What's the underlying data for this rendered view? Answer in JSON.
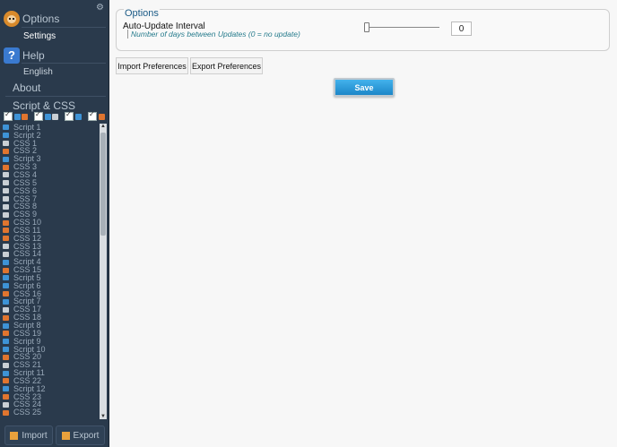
{
  "sidebar": {
    "options_title": "Options",
    "settings_label": "Settings",
    "help_title": "Help",
    "english_label": "English",
    "about_label": "About",
    "script_css_label": "Script & CSS",
    "items": [
      {
        "label": "Script 1",
        "kind": "script"
      },
      {
        "label": "Script 2",
        "kind": "script"
      },
      {
        "label": "CSS 1",
        "kind": "css"
      },
      {
        "label": "CSS 2",
        "kind": "cssor"
      },
      {
        "label": "Script 3",
        "kind": "script"
      },
      {
        "label": "CSS 3",
        "kind": "cssor"
      },
      {
        "label": "CSS 4",
        "kind": "css"
      },
      {
        "label": "CSS 5",
        "kind": "css"
      },
      {
        "label": "CSS 6",
        "kind": "css"
      },
      {
        "label": "CSS 7",
        "kind": "css"
      },
      {
        "label": "CSS 8",
        "kind": "css"
      },
      {
        "label": "CSS 9",
        "kind": "css"
      },
      {
        "label": "CSS 10",
        "kind": "cssor"
      },
      {
        "label": "CSS 11",
        "kind": "cssor"
      },
      {
        "label": "CSS 12",
        "kind": "cssor"
      },
      {
        "label": "CSS 13",
        "kind": "css"
      },
      {
        "label": "CSS 14",
        "kind": "css"
      },
      {
        "label": "Script 4",
        "kind": "script"
      },
      {
        "label": "CSS 15",
        "kind": "cssor"
      },
      {
        "label": "Script 5",
        "kind": "script"
      },
      {
        "label": "Script 6",
        "kind": "script"
      },
      {
        "label": "CSS 16",
        "kind": "cssor"
      },
      {
        "label": "Script 7",
        "kind": "script"
      },
      {
        "label": "CSS 17",
        "kind": "css"
      },
      {
        "label": "CSS 18",
        "kind": "cssor"
      },
      {
        "label": "Script 8",
        "kind": "script"
      },
      {
        "label": "CSS 19",
        "kind": "cssor"
      },
      {
        "label": "Script 9",
        "kind": "script"
      },
      {
        "label": "Script 10",
        "kind": "script"
      },
      {
        "label": "CSS 20",
        "kind": "cssor"
      },
      {
        "label": "CSS 21",
        "kind": "css"
      },
      {
        "label": "Script 11",
        "kind": "script"
      },
      {
        "label": "CSS 22",
        "kind": "cssor"
      },
      {
        "label": "Script 12",
        "kind": "script"
      },
      {
        "label": "CSS 23",
        "kind": "cssor"
      },
      {
        "label": "CSS 24",
        "kind": "css"
      },
      {
        "label": "CSS 25",
        "kind": "cssor"
      }
    ],
    "import_label": "Import",
    "export_label": "Export"
  },
  "main": {
    "options_legend": "Options",
    "auto_update_label": "Auto-Update Interval",
    "auto_update_hint": "Number of days between Updates (0 = no update)",
    "auto_update_value": "0",
    "import_prefs_label": "Import Preferences",
    "export_prefs_label": "Export Preferences",
    "save_label": "Save"
  },
  "colors": {
    "sidebar_bg": "#2a3a4c",
    "save_button": "#2a9ad9",
    "legend_text": "#1a5a86",
    "hint_text": "#277c8d"
  }
}
